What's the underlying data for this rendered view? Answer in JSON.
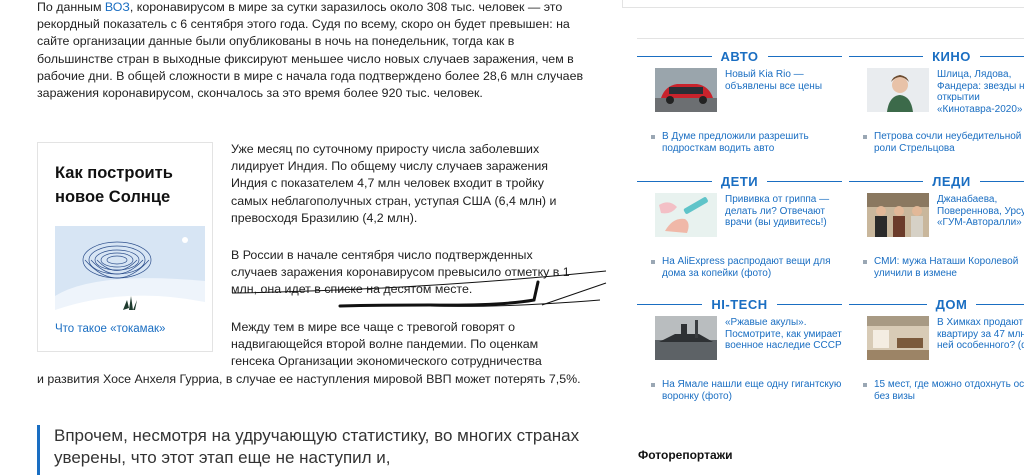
{
  "article": {
    "p1_pre": "По данным ",
    "p1_link": "ВОЗ",
    "p1_post": ", коронавирусом в мире за сутки заразилось около 308 тыс. человек — это рекордный показатель с 6 сентября этого года. Судя по всему, скоро он будет превышен: на сайте организации данные были опубликованы в ночь на понедельник, тогда как в большинстве стран в выходные фиксируют меньшее число новых случаев заражения, чем в рабочие дни. В общей сложности в мире с начала года подтверждено более 28,6 млн случаев заражения коронавирусом, скончалось за это время более 920 тыс. человек.",
    "p2": "Уже месяц по суточному приросту числа заболевших лидирует Индия. По общему числу случаев заражения Индия с показателем 4,7 млн человек входит в тройку самых неблагополучных стран, уступая США (6,4 млн) и превосходя Бразилию (4,2 млн).",
    "p3": "В России в начале сентября число подтвержденных случаев заражения коронавирусом превысило отметку в 1 млн, она идет в списке на десятом месте.",
    "p4a": "Между тем в мире все чаще с тревогой говорят о надвигающейся второй волне пандемии. По оценкам генсека Организации экономического сотрудничества",
    "p4b": "и развития Хосе Анхеля Гурриа, в случае ее наступления мировой ВВП может потерять 7,5%.",
    "quote": "Впрочем, несмотря на удручающую статистику, во многих странах уверены, что этот этап еще не наступил и,"
  },
  "aside": {
    "title": "Как построить новое Солнце",
    "link": "Что такое «токамак»"
  },
  "news": {
    "left": [
      {
        "label": "АВТО",
        "lead": "Новый Kia Rio — объявлены все цены",
        "item": "В Думе предложили разрешить подросткам водить авто"
      },
      {
        "label": "ДЕТИ",
        "lead": "Прививка от гриппа — делать ли? Отвечают врачи (вы удивитесь!)",
        "item": "На AliExpress распродают вещи для дома за копейки (фото)"
      },
      {
        "label": "HI-TECH",
        "lead": "«Ржавые акулы». Посмотрите, как умирает военное наследие СССР",
        "item": "На Ямале нашли еще одну гигантскую воронку (фото)"
      }
    ],
    "right": [
      {
        "label": "КИНО",
        "lead": "Шлица, Лядова, Фандера: звезды на открытии «Кинотавра-2020»",
        "item": "Петрова сочли неубедительной в роли Стрельцова"
      },
      {
        "label": "ЛЕДИ",
        "lead": "Джанабаева, Повереннова, Урсуляк на «ГУМ-Авторалли» (фото)",
        "item": "СМИ: мужа Наташи Королевой уличили в измене"
      },
      {
        "label": "ДОМ",
        "lead": "В Химках продают квартиру за 47 млн. Что в ней особенного? (фото)",
        "item": "15 мест, где можно отдохнуть осенью без визы"
      }
    ],
    "photo_title": "Фоторепортажи"
  },
  "colors": {
    "accent": "#1a6ec2"
  }
}
